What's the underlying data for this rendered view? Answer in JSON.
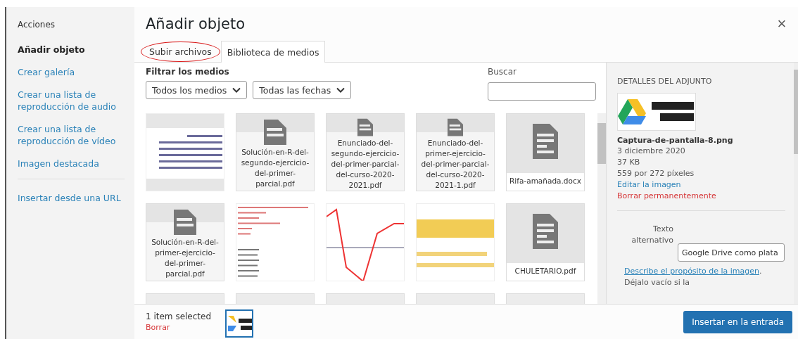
{
  "sidebar": {
    "heading": "Acciones",
    "items": [
      {
        "label": "Añadir objeto",
        "selected": true
      },
      {
        "label": "Crear galería",
        "selected": false
      },
      {
        "label": "Crear una lista de reproducción de audio",
        "selected": false
      },
      {
        "label": "Crear una lista de reproducción de vídeo",
        "selected": false
      },
      {
        "label": "Imagen destacada",
        "selected": false
      }
    ],
    "footer_items": [
      {
        "label": "Insertar desde una URL",
        "selected": false
      }
    ]
  },
  "modal": {
    "title": "Añadir objeto",
    "close": "×"
  },
  "tabs": [
    {
      "label": "Subir archivos",
      "selected": false,
      "annotated": true
    },
    {
      "label": "Biblioteca de medios",
      "selected": true,
      "annotated": false
    }
  ],
  "filters": {
    "heading": "Filtrar los medios",
    "dropdowns": [
      {
        "value": "Todos los medios"
      },
      {
        "value": "Todas las fechas"
      }
    ],
    "search_label": "Buscar"
  },
  "tiles": [
    {
      "kind": "table-image"
    },
    {
      "kind": "file",
      "caption": "Solución-en-R-del-segundo-ejercicio-del-primer-parcial.pdf"
    },
    {
      "kind": "file",
      "caption": "Enunciado-del-segundo-ejercicio-del-primer-parcial-del-curso-2020-2021.pdf"
    },
    {
      "kind": "file",
      "caption": "Enunciado-del-primer-ejercicio-del-primer-parcial-del-curso-2020-2021-1.pdf"
    },
    {
      "kind": "document",
      "caption": "Rifa-amañada.docx"
    },
    {
      "kind": "file",
      "caption": "Solución-en-R-del-primer-ejercicio-del-primer-parcial.pdf"
    },
    {
      "kind": "code-image"
    },
    {
      "kind": "graph-image"
    },
    {
      "kind": "banner-image"
    },
    {
      "kind": "document",
      "caption": "CHULETARIO.pdf"
    },
    {
      "kind": "blank"
    },
    {
      "kind": "blank"
    },
    {
      "kind": "blank"
    },
    {
      "kind": "blank"
    },
    {
      "kind": "blank"
    }
  ],
  "details": {
    "heading": "DETALLES DEL ADJUNTO",
    "filename": "Captura-de-pantalla-8.png",
    "date": "3 diciembre 2020",
    "size": "37 KB",
    "dimensions": "559 por 272 píxeles",
    "edit_link": "Editar la imagen",
    "delete_link": "Borrar permanentemente",
    "alt_label": "Texto alternativo",
    "alt_value": "Google Drive como plata",
    "alt_help_link": "Describe el propósito de la imagen",
    "alt_help_text": ". Déjalo vacío si la"
  },
  "toolbar": {
    "selection_count": "1 item selected",
    "clear": "Borrar",
    "button": "Insertar en la entrada"
  }
}
